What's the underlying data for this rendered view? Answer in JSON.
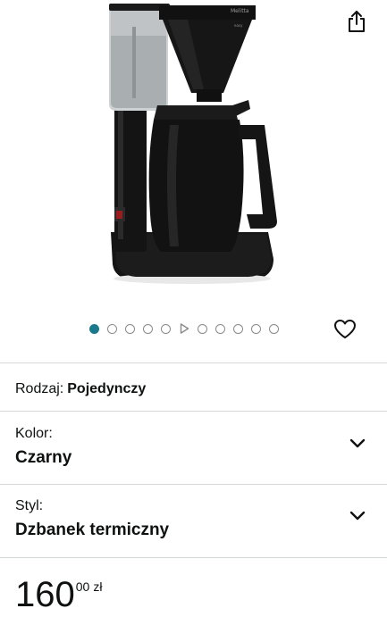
{
  "product": {
    "image_brand_text": "Melitta",
    "image_model_text": "easy"
  },
  "gallery": {
    "items": [
      "dot",
      "dot",
      "dot",
      "dot",
      "dot",
      "play",
      "dot",
      "dot",
      "dot",
      "dot",
      "dot"
    ],
    "active_index": 0,
    "accent_color": "#1a7a8c"
  },
  "icons": {
    "share": "share-icon",
    "favorite": "heart-icon",
    "chevron": "chevron-down-icon"
  },
  "options": {
    "rodzaj": {
      "label": "Rodzaj:",
      "value": "Pojedynczy"
    },
    "kolor": {
      "label": "Kolor:",
      "value": "Czarny"
    },
    "styl": {
      "label": "Styl:",
      "value": "Dzbanek termiczny"
    }
  },
  "price": {
    "whole": "160",
    "fraction": "00",
    "currency": "zł"
  }
}
